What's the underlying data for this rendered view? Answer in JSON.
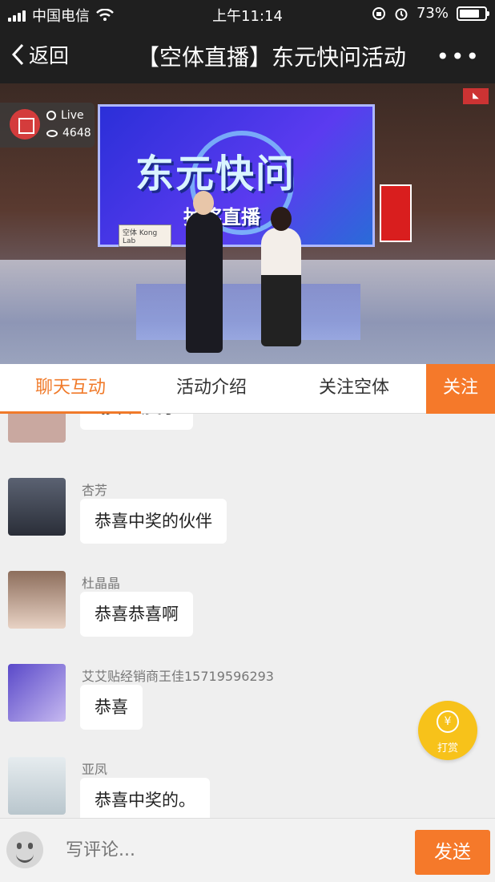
{
  "status": {
    "carrier": "中国电信",
    "time": "上午11:14",
    "battery": "73%"
  },
  "nav": {
    "back_label": "返回",
    "title": "【空体直播】东元快问活动",
    "more_label": "•••"
  },
  "video": {
    "live_label": "Live",
    "viewer_count": "4648",
    "screen_title": "东元快问",
    "screen_subtitle": "抽奖直播",
    "board_logo": "空体 Kong Lab"
  },
  "tabs": [
    {
      "label": "聊天互动",
      "active": true
    },
    {
      "label": "活动介绍",
      "active": false
    },
    {
      "label": "关注空体",
      "active": false
    }
  ],
  "follow_label": "关注",
  "messages": [
    {
      "user": "",
      "text": "谢中大奖了",
      "avatar": "#c9a8a0"
    },
    {
      "user": "杏芳",
      "text": "恭喜中奖的伙伴",
      "avatar": "#3a3f4c"
    },
    {
      "user": "杜晶晶",
      "text": "恭喜恭喜啊",
      "avatar": "#c2a58e"
    },
    {
      "user": "艾艾贴经销商王佳15719596293",
      "text": "恭喜",
      "avatar": "#7b6ad2"
    },
    {
      "user": "亚凤",
      "text": "恭喜中奖的。",
      "avatar": "#cdd7dc"
    }
  ],
  "reward_label": "打赏",
  "comment": {
    "placeholder": "写评论..."
  },
  "send_label": "发送",
  "colors": {
    "accent": "#f5792a",
    "reward": "#f7c21a"
  }
}
